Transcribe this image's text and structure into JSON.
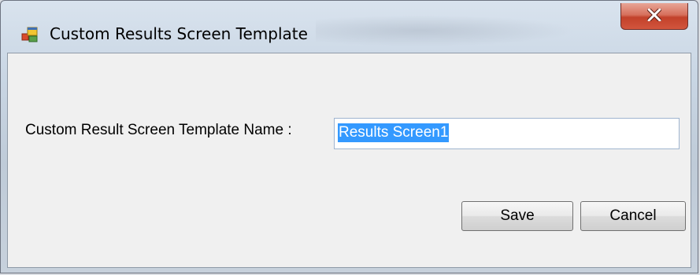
{
  "window": {
    "title": "Custom Results Screen Template",
    "close_symbol": "X",
    "icon": "application-window-icon"
  },
  "form": {
    "label": "Custom Result Screen Template Name :",
    "input_value": "Results Screen1"
  },
  "buttons": {
    "save_label": "Save",
    "cancel_label": "Cancel"
  },
  "colors": {
    "selection_highlight": "#3399ff",
    "close_button": "#c2412a"
  }
}
